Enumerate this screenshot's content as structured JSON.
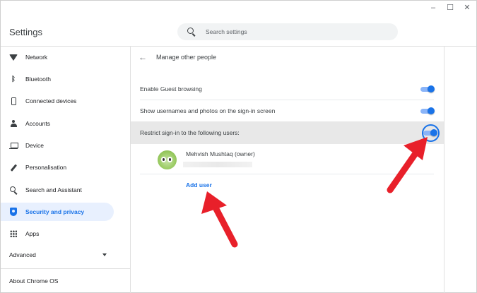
{
  "window": {
    "controls": [
      "–",
      "☐",
      "✕"
    ]
  },
  "header": {
    "title": "Settings",
    "search_placeholder": "Search settings"
  },
  "sidebar": {
    "items": [
      {
        "label": "Network",
        "icon": "wifi-icon"
      },
      {
        "label": "Bluetooth",
        "icon": "bluetooth-icon"
      },
      {
        "label": "Connected devices",
        "icon": "phone-icon"
      },
      {
        "label": "Accounts",
        "icon": "person-icon"
      },
      {
        "label": "Device",
        "icon": "laptop-icon"
      },
      {
        "label": "Personalisation",
        "icon": "brush-icon"
      },
      {
        "label": "Search and Assistant",
        "icon": "search-icon"
      },
      {
        "label": "Security and privacy",
        "icon": "shield-icon",
        "active": true
      },
      {
        "label": "Apps",
        "icon": "apps-grid-icon"
      }
    ],
    "advanced": "Advanced",
    "about": "About Chrome OS"
  },
  "main": {
    "title": "Manage other people",
    "settings": [
      {
        "label": "Enable Guest browsing",
        "enabled": true
      },
      {
        "label": "Show usernames and photos on the sign-in screen",
        "enabled": true
      },
      {
        "label": "Restrict sign-in to the following users:",
        "enabled": true
      }
    ],
    "user": {
      "name": "Mehvish Mushtaq (owner)"
    },
    "add_user": "Add user"
  },
  "colors": {
    "accent": "#1a73e8",
    "annotation_arrow": "#e8202a",
    "active_bg": "#e8f0fe"
  }
}
